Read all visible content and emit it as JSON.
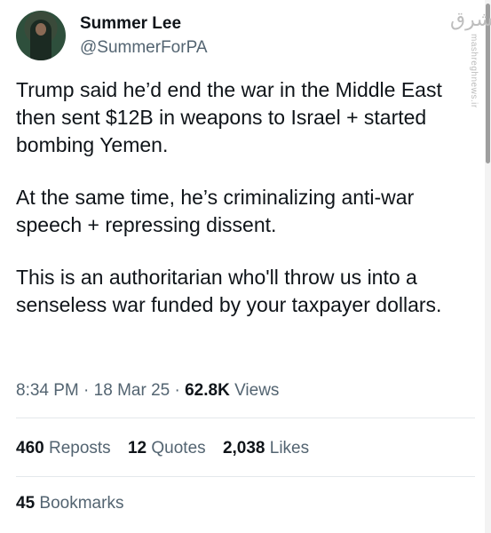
{
  "author": {
    "display_name": "Summer Lee",
    "handle": "@SummerForPA"
  },
  "tweet": {
    "paragraphs": [
      "Trump said he’d end the war in the Middle East then sent $12B in weapons to Israel + started bombing Yemen.",
      "At the same time, he’s criminalizing anti-war speech + repressing dissent.",
      "This is an authoritarian who'll throw us into a senseless war funded by your taxpayer dollars."
    ],
    "time": "8:34 PM",
    "date": "18 Mar 25",
    "views_count": "62.8K",
    "views_label": "Views",
    "separator": "·"
  },
  "stats": {
    "reposts_count": "460",
    "reposts_label": "Reposts",
    "quotes_count": "12",
    "quotes_label": "Quotes",
    "likes_count": "2,038",
    "likes_label": "Likes",
    "bookmarks_count": "45",
    "bookmarks_label": "Bookmarks"
  },
  "watermark": {
    "logo": "مشرق",
    "site": "mashreghnews.ir"
  },
  "colors": {
    "text": "#0f1419",
    "secondary": "#536471",
    "divider": "#e4e8eb"
  }
}
